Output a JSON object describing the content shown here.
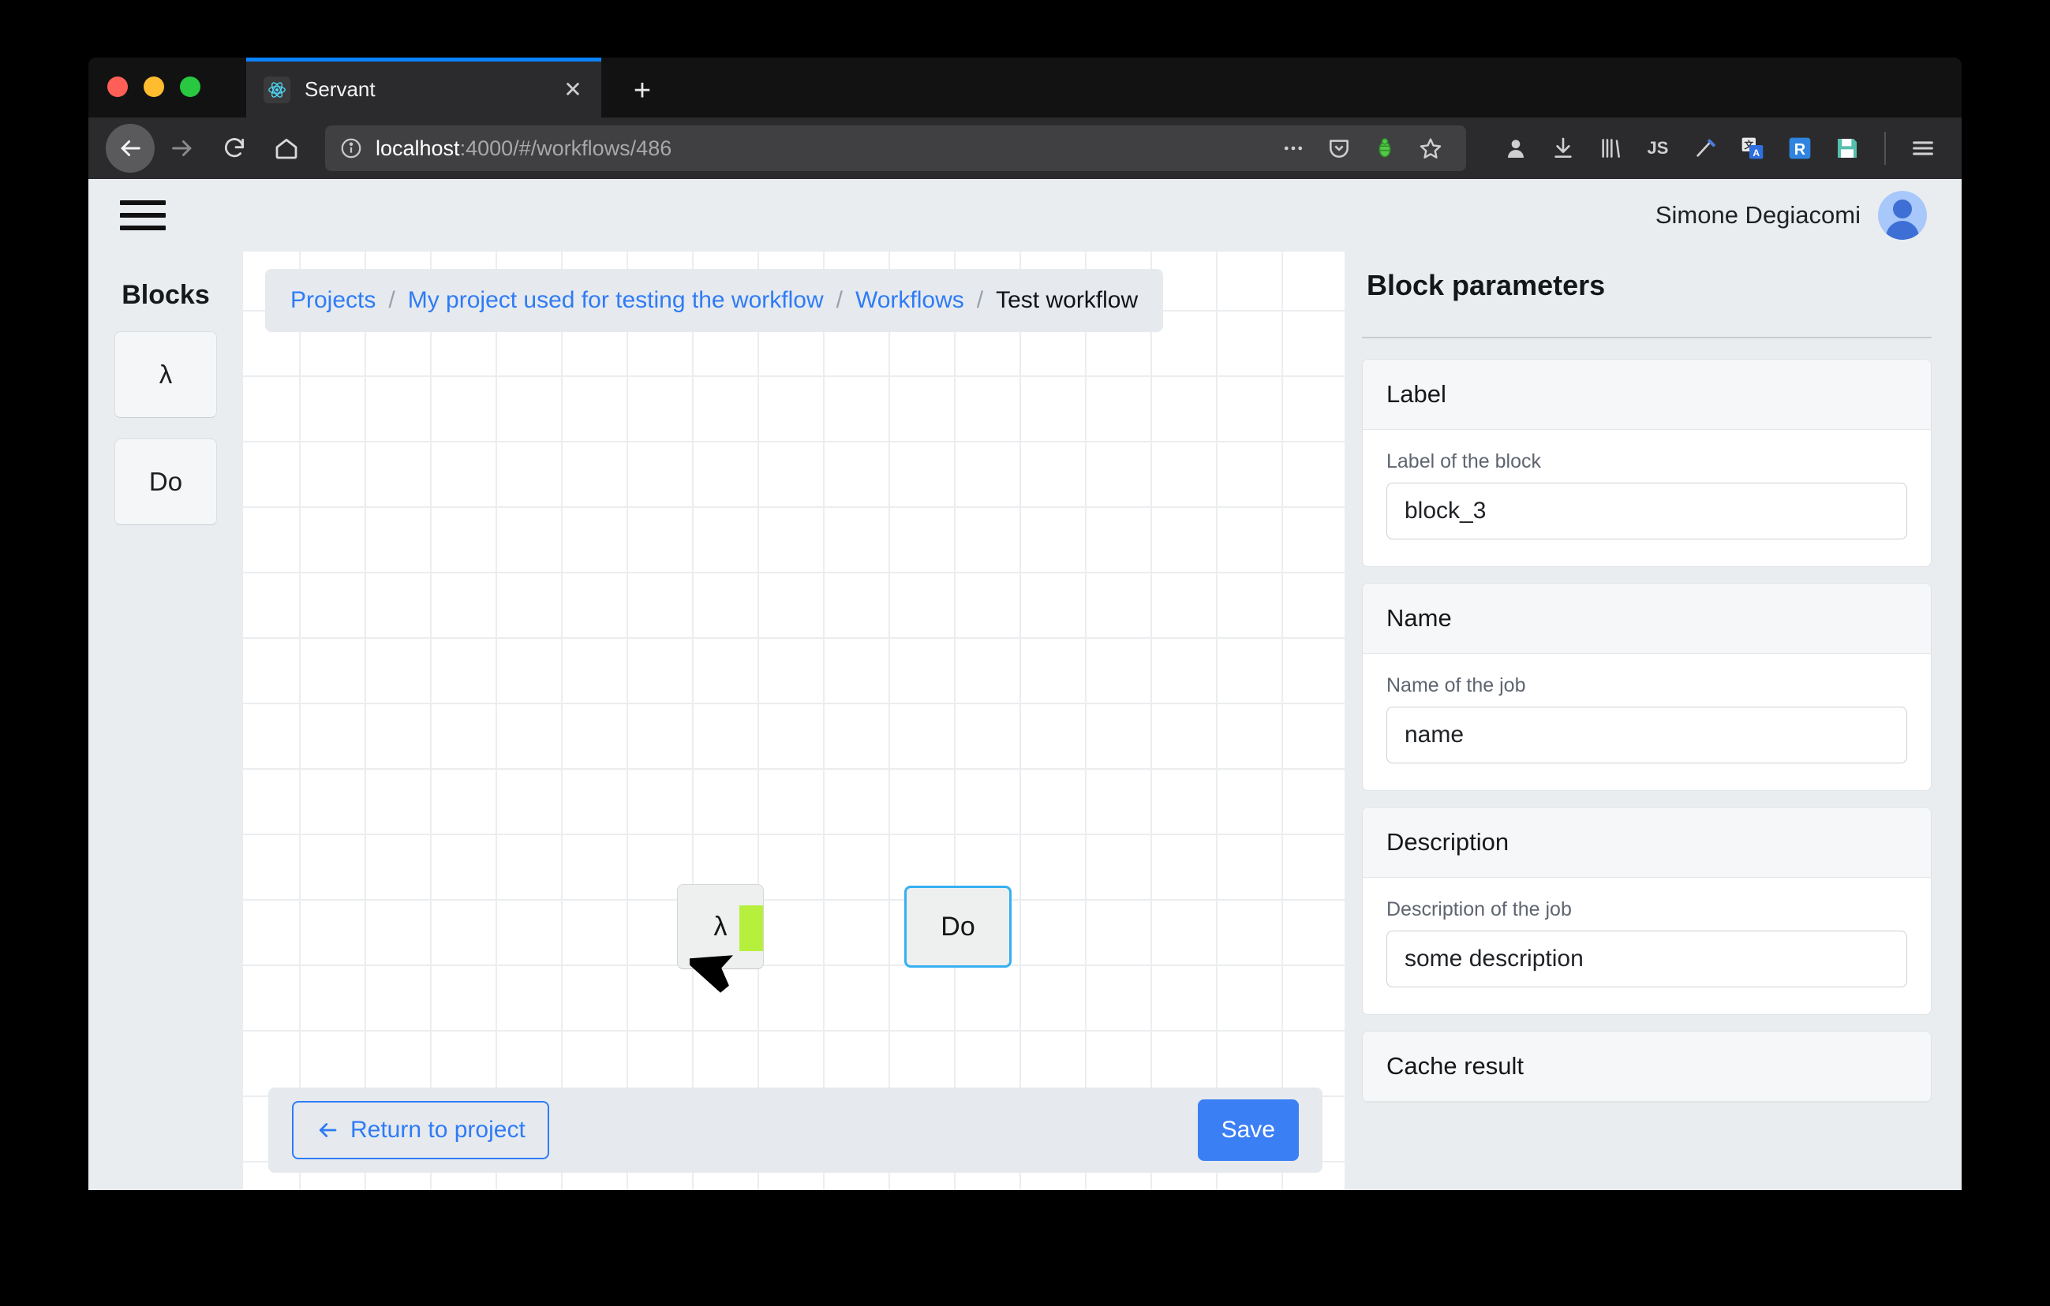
{
  "browser": {
    "tab": {
      "title": "Servant",
      "icon": "react-logo-icon",
      "close_icon": "close-icon"
    },
    "new_tab_icon": "plus-icon",
    "nav": {
      "back_icon": "back-arrow-icon",
      "forward_icon": "forward-arrow-icon",
      "reload_icon": "reload-icon",
      "home_icon": "home-icon"
    },
    "url": {
      "host": "localhost",
      "rest": ":4000/#/workflows/486",
      "info_icon": "info-circle-icon"
    },
    "url_actions": [
      "ellipsis-icon",
      "pocket-icon",
      "bug-icon",
      "star-icon"
    ],
    "extensions": [
      "account-icon",
      "download-icon",
      "library-icon",
      "js-icon",
      "marker-icon",
      "translate-icon",
      "r-icon",
      "save-disk-icon"
    ],
    "menu_icon": "hamburger-menu-icon"
  },
  "app": {
    "menu_icon": "app-hamburger-icon",
    "user": {
      "name": "Simone Degiacomi",
      "avatar_icon": "user-avatar-icon"
    }
  },
  "palette": {
    "title": "Blocks",
    "blocks": [
      {
        "label": "λ",
        "name": "lambda"
      },
      {
        "label": "Do",
        "name": "do"
      }
    ]
  },
  "breadcrumb": {
    "items": [
      {
        "label": "Projects",
        "current": false
      },
      {
        "label": "My project used for testing the workflow",
        "current": false
      },
      {
        "label": "Workflows",
        "current": false
      },
      {
        "label": "Test workflow",
        "current": true
      }
    ],
    "separator": "/"
  },
  "canvas": {
    "nodes": [
      {
        "label": "λ",
        "name": "lambda-node",
        "selected": false,
        "connector_color": "#b6f03c"
      },
      {
        "label": "Do",
        "name": "do-node",
        "selected": true,
        "border_color": "#36b0f0"
      }
    ],
    "cursor_icon": "mouse-pointer-icon"
  },
  "actions": {
    "return_label": "Return to project",
    "return_icon": "left-arrow-icon",
    "save_label": "Save"
  },
  "parameters": {
    "title": "Block parameters",
    "cards": [
      {
        "header": "Label",
        "field_label": "Label of the block",
        "value": "block_3",
        "input_name": "label-input"
      },
      {
        "header": "Name",
        "field_label": "Name of the job",
        "value": "name",
        "input_name": "job-name-input"
      },
      {
        "header": "Description",
        "field_label": "Description of the job",
        "value": "some description",
        "input_name": "job-description-input"
      },
      {
        "header": "Cache result",
        "field_label": "",
        "value": "",
        "input_name": "cache-result-input"
      }
    ]
  },
  "colors": {
    "accent_blue": "#3b7ff5",
    "link_blue": "#2f7bf6",
    "select_blue": "#36b0f0",
    "connector_green": "#b6f03c",
    "page_bg": "#e9edf0"
  }
}
